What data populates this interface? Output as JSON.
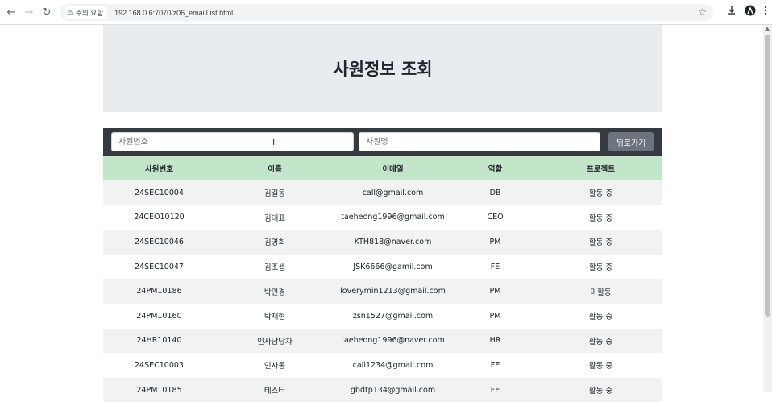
{
  "browser": {
    "back": "←",
    "forward": "→",
    "reload": "↻",
    "security_label": "주의 요함",
    "url": "192.168.0.6:7070/z06_emailList.html",
    "star": "☆"
  },
  "page": {
    "title": "사원정보 조회"
  },
  "search": {
    "emp_no_placeholder": "사원번호",
    "emp_name_placeholder": "사원명",
    "back_label": "뒤로가기"
  },
  "table": {
    "headers": [
      "사원번호",
      "이름",
      "이메일",
      "역할",
      "프로젝트"
    ],
    "rows": [
      [
        "24SEC10004",
        "김길동",
        "call@gmail.com",
        "DB",
        "활동 중"
      ],
      [
        "24CEO10120",
        "김대표",
        "taeheong1996@gmail.com",
        "CEO",
        "활동 중"
      ],
      [
        "24SEC10046",
        "김영희",
        "KTH818@naver.com",
        "PM",
        "활동 중"
      ],
      [
        "24SEC10047",
        "김조셉",
        "JSK6666@gamil.com",
        "FE",
        "활동 중"
      ],
      [
        "24PM10186",
        "박민경",
        "loverymin1213@gmail.com",
        "PM",
        "미활동"
      ],
      [
        "24PM10160",
        "박재현",
        "zsn1527@gmail.com",
        "PM",
        "활동 중"
      ],
      [
        "24HR10140",
        "인사담당자",
        "taeheong1996@naver.com",
        "HR",
        "활동 중"
      ],
      [
        "24SEC10003",
        "인사동",
        "call1234@gmail.com",
        "FE",
        "활동 중"
      ],
      [
        "24PM10185",
        "테스터",
        "gbdtp134@gmail.com",
        "FE",
        "활동 중"
      ]
    ]
  }
}
